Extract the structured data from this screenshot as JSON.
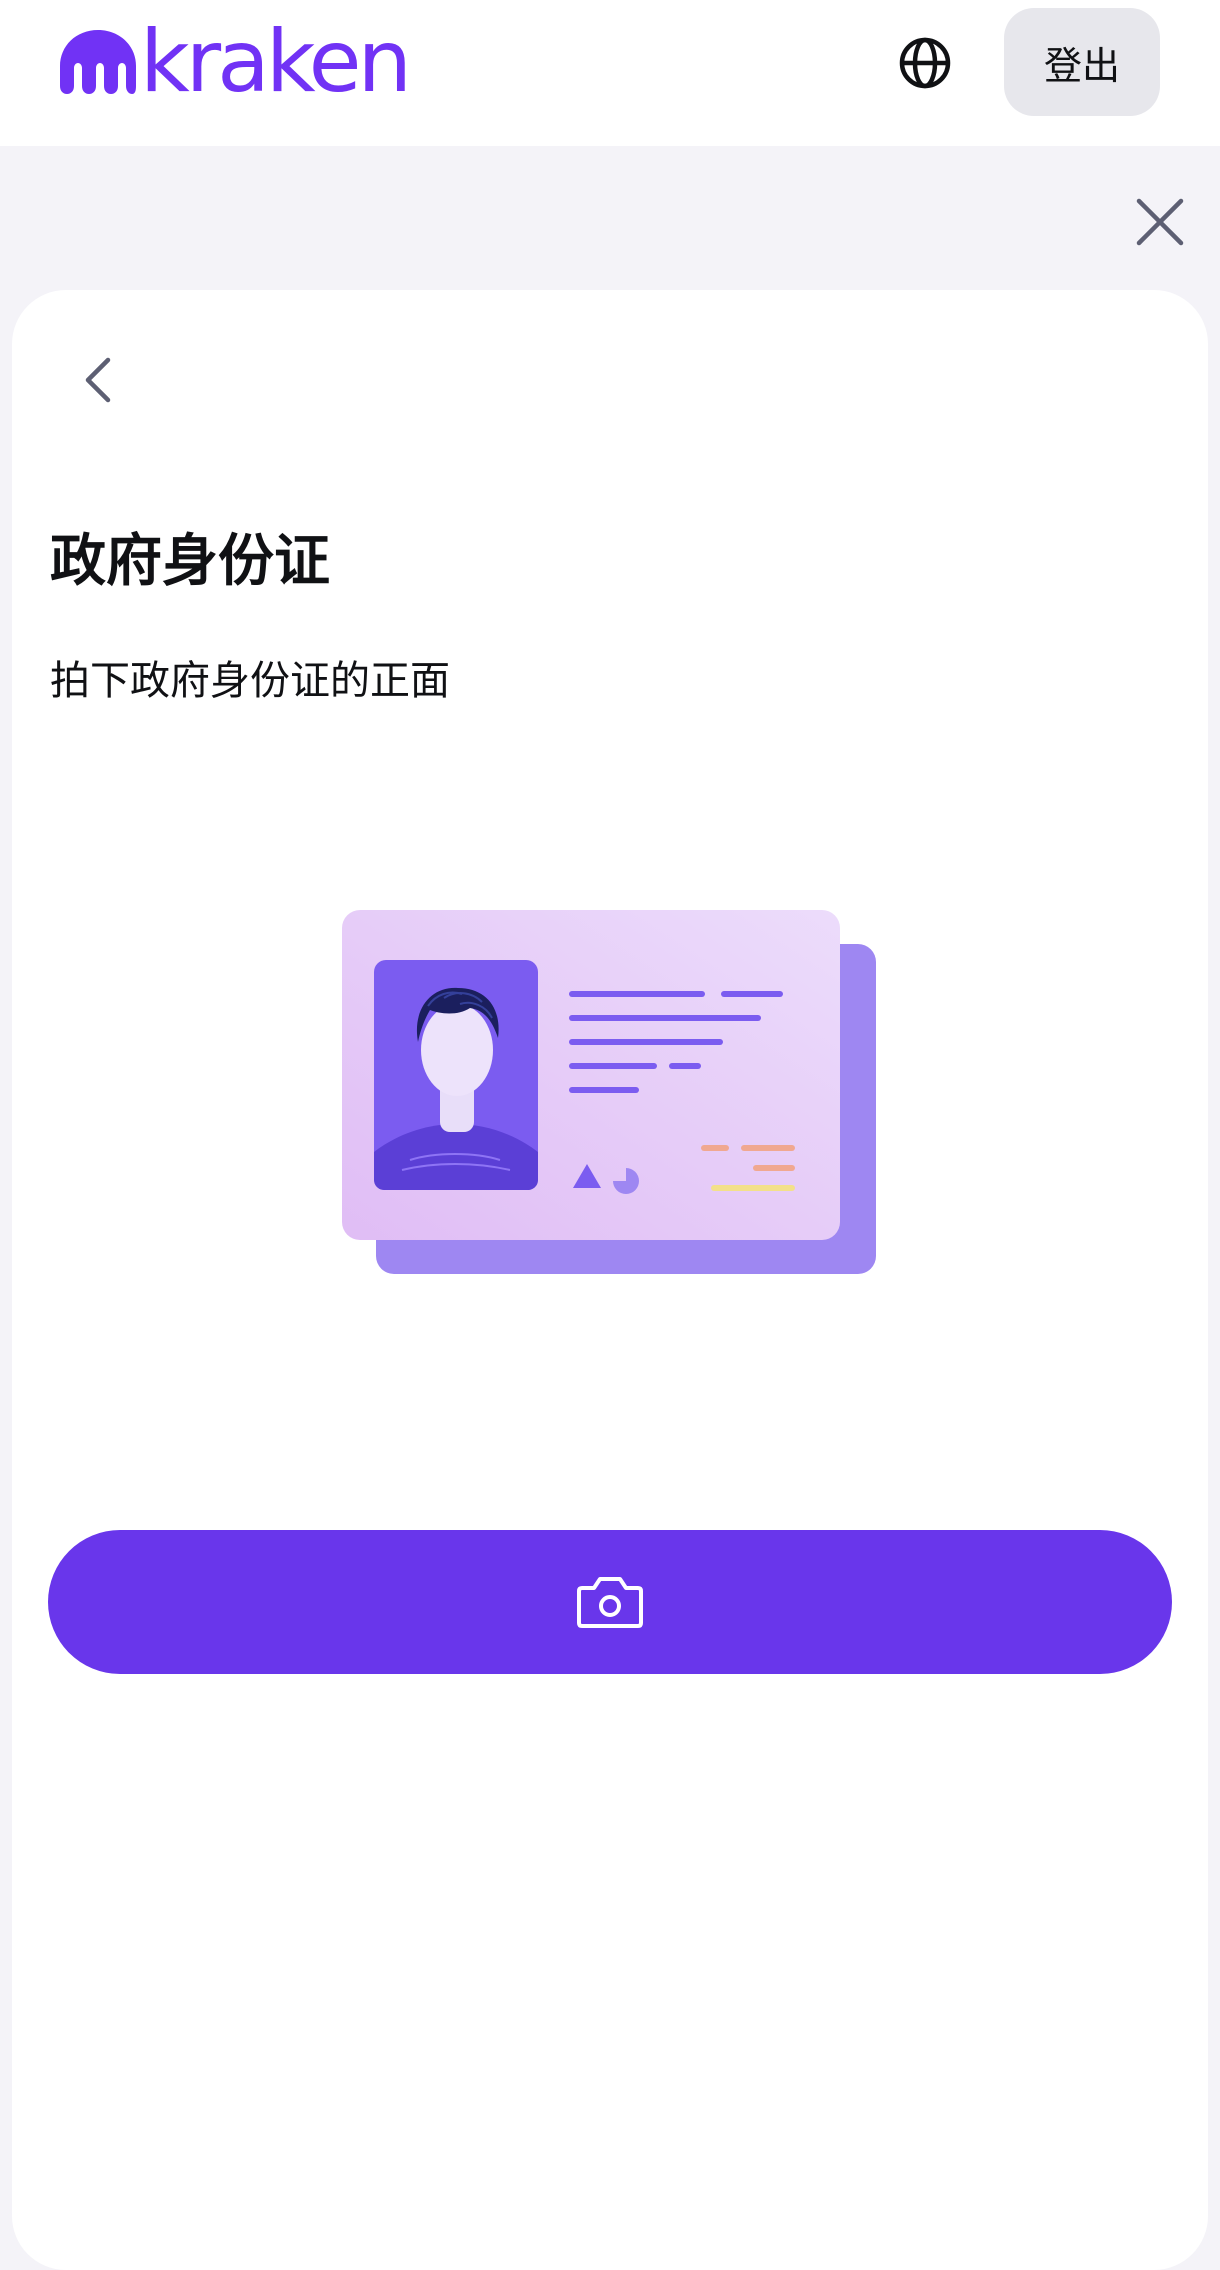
{
  "header": {
    "logo_text": "kraken",
    "logout_label": "登出",
    "globe_icon": "globe-icon"
  },
  "close_icon": "close-icon",
  "card": {
    "back_icon": "chevron-left-icon",
    "title": "政府身份证",
    "subtitle": "拍下政府身份证的正面",
    "illustration": "id-card-illustration",
    "camera_icon": "camera-icon"
  },
  "colors": {
    "brand": "#7132f5",
    "button": "#6936eb",
    "page_bg": "#f4f3f8",
    "logout_bg": "#e7e7ec"
  }
}
